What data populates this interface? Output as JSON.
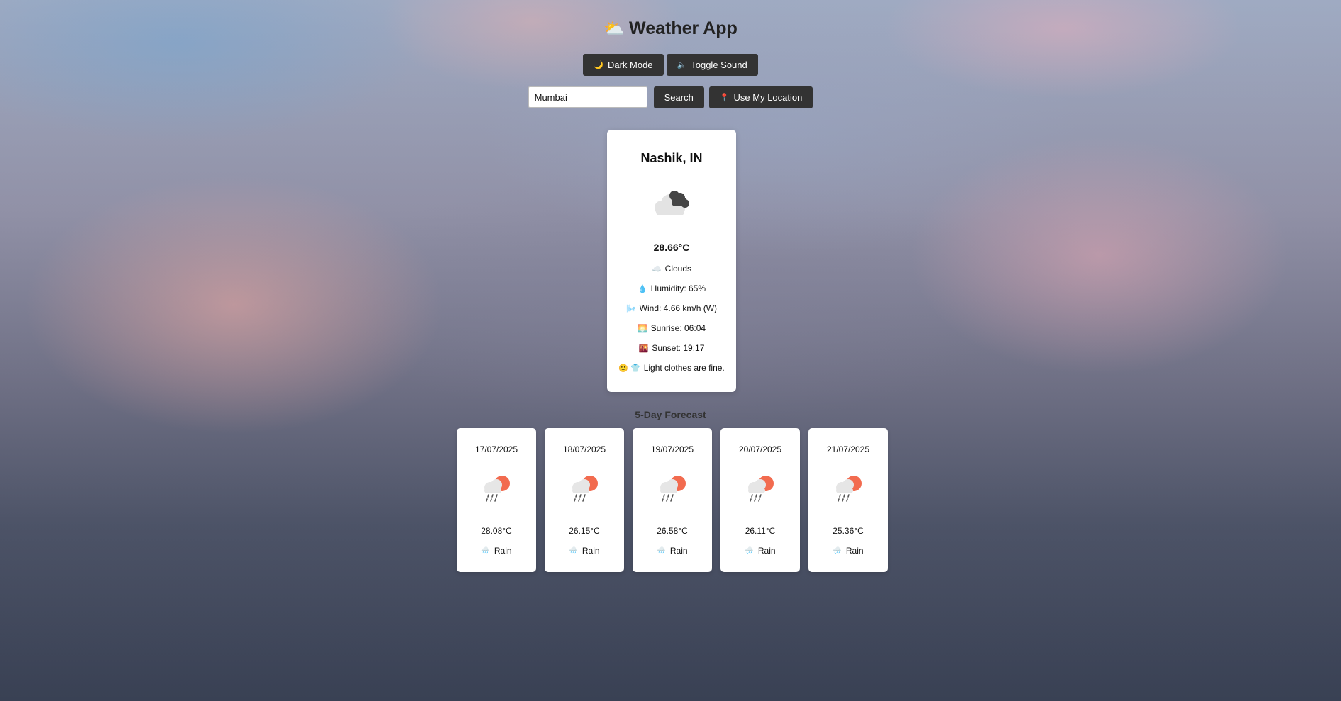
{
  "app": {
    "title": "Weather App",
    "title_icon": "⛅"
  },
  "controls": {
    "dark_mode_icon": "🌙",
    "dark_mode_label": "Dark Mode",
    "sound_icon": "🔈",
    "sound_label": "Toggle Sound"
  },
  "search": {
    "value": "Mumbai",
    "search_label": "Search",
    "location_icon": "📍",
    "location_label": "Use My Location"
  },
  "current": {
    "city": "Nashik, IN",
    "icon": "broken-clouds-icon",
    "temperature": "28.66°C",
    "condition_icon": "☁️",
    "condition": "Clouds",
    "humidity_icon": "💧",
    "humidity": "Humidity: 65%",
    "wind_icon": "🌬️",
    "wind": "Wind: 4.66 km/h (W)",
    "sunrise_icon": "🌅",
    "sunrise": "Sunrise: 06:04",
    "sunset_icon": "🌇",
    "sunset": "Sunset: 19:17",
    "advice_icons": "🙂 👕",
    "advice": "Light clothes are fine."
  },
  "forecast": {
    "title": "5-Day Forecast",
    "days": [
      {
        "date": "17/07/2025",
        "icon": "rain-sun-icon",
        "temp": "28.08°C",
        "desc_icon": "🌧️",
        "desc": "Rain"
      },
      {
        "date": "18/07/2025",
        "icon": "rain-sun-icon",
        "temp": "26.15°C",
        "desc_icon": "🌧️",
        "desc": "Rain"
      },
      {
        "date": "19/07/2025",
        "icon": "rain-sun-icon",
        "temp": "26.58°C",
        "desc_icon": "🌧️",
        "desc": "Rain"
      },
      {
        "date": "20/07/2025",
        "icon": "rain-sun-icon",
        "temp": "26.11°C",
        "desc_icon": "🌧️",
        "desc": "Rain"
      },
      {
        "date": "21/07/2025",
        "icon": "rain-sun-icon",
        "temp": "25.36°C",
        "desc_icon": "🌧️",
        "desc": "Rain"
      }
    ]
  },
  "colors": {
    "button_bg": "#333333",
    "card_bg": "#ffffff",
    "sun": "#f26b4f",
    "cloud_dark": "#444444",
    "cloud_light": "#e8e8e8"
  }
}
